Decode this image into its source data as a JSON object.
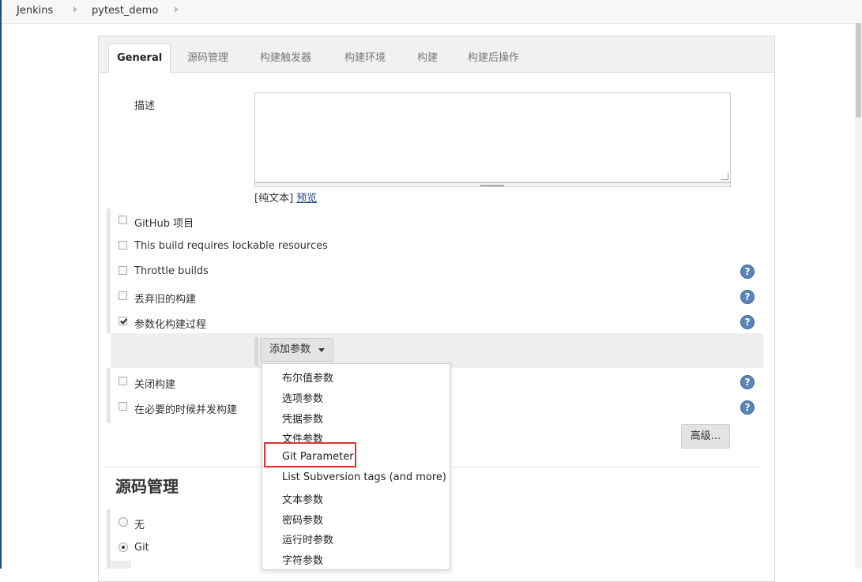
{
  "breadcrumb": {
    "items": [
      "Jenkins",
      "pytest_demo"
    ]
  },
  "tabs": [
    {
      "label": "General",
      "active": true
    },
    {
      "label": "源码管理",
      "active": false
    },
    {
      "label": "构建触发器",
      "active": false
    },
    {
      "label": "构建环境",
      "active": false
    },
    {
      "label": "构建",
      "active": false
    },
    {
      "label": "构建后操作",
      "active": false
    }
  ],
  "general": {
    "description_label": "描述",
    "description_value": "",
    "plain_text_label": "[纯文本]",
    "preview_link": "预览",
    "options": [
      {
        "label": "GitHub 项目",
        "checked": false,
        "help": false
      },
      {
        "label": "This build requires lockable resources",
        "checked": false,
        "help": false
      },
      {
        "label": "Throttle builds",
        "checked": false,
        "help": true
      },
      {
        "label": "丢弃旧的构建",
        "checked": false,
        "help": true
      },
      {
        "label": "参数化构建过程",
        "checked": true,
        "help": true
      }
    ],
    "add_parameter_button": "添加参数",
    "options_after": [
      {
        "label": "关闭构建",
        "checked": false,
        "help": true
      },
      {
        "label": "在必要的时候并发构建",
        "checked": false,
        "help": true
      }
    ],
    "advanced_button": "高级..."
  },
  "parameter_menu": {
    "items": [
      "布尔值参数",
      "选项参数",
      "凭据参数",
      "文件参数",
      "Git Parameter",
      "List Subversion tags (and more)",
      "文本参数",
      "密码参数",
      "运行时参数",
      "字符参数"
    ],
    "highlighted_item": "Git Parameter",
    "highlight_color": "#e0342e"
  },
  "scm": {
    "title": "源码管理",
    "options": [
      {
        "label": "无",
        "selected": false
      },
      {
        "label": "Git",
        "selected": true
      }
    ]
  },
  "colors": {
    "help_icon": "#5b84b7",
    "link": "#204a87"
  },
  "icons": {
    "help": "?"
  }
}
